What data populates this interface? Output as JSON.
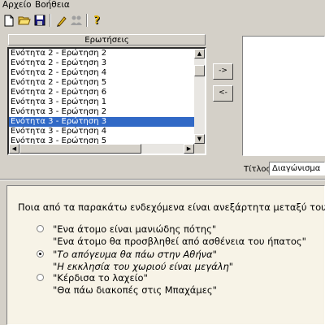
{
  "menu": {
    "file": "Αρχείο",
    "help": "Βοήθεια"
  },
  "toolbar": {
    "icons": [
      "new-icon",
      "open-icon",
      "save-icon",
      "edit-icon",
      "users-icon",
      "help-icon"
    ],
    "help_glyph": "?"
  },
  "questions": {
    "header": "Ερωτήσεις",
    "items": [
      "Ενότητα 2 - Ερώτηση 2",
      "Ενότητα 2 - Ερώτηση 3",
      "Ενότητα 2 - Ερώτηση 4",
      "Ενότητα 2 - Ερώτηση 5",
      "Ενότητα 2 - Ερώτηση 6",
      "Ενότητα 3 - Ερώτηση 1",
      "Ενότητα 3 - Ερώτηση 2",
      "Ενότητα 3 - Ερώτηση 3",
      "Ενότητα 3 - Ερώτηση 4",
      "Ενότητα 3 - Ερώτηση 5"
    ],
    "selected_index": 7
  },
  "buttons": {
    "add": "->",
    "remove": "<-"
  },
  "title_field": {
    "label": "Τίτλος:",
    "value": "Διαγώνισμα"
  },
  "question": {
    "text": "Ποια από τα παρακάτω ενδεχόμενα είναι ανεξάρτητα μεταξύ τους ;",
    "answers": [
      {
        "line1": "\"Ενα άτομο είναι μανιώδης πότης\"",
        "line2": "\"Ενα άτομο θα προσβληθεί από ασθένεια του ήπατος\"",
        "selected": false
      },
      {
        "line1": "\"Το απόγευμα θα πάω στην Αθήνα\"",
        "line2": "\"Η εκκλησία του χωριού είναι μεγάλη\"",
        "selected": true
      },
      {
        "line1": "\"Κέρδισα το λαχείο\"",
        "line2": "\"Θα πάω διακοπές στις Μπαχάμες\"",
        "selected": false
      }
    ]
  }
}
